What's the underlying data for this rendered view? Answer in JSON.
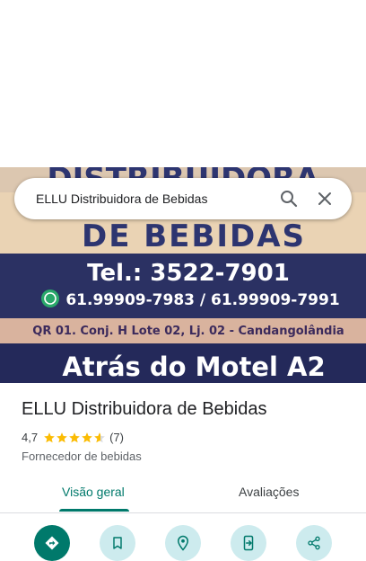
{
  "search": {
    "query": "ELLU Distribuidora de Bebidas"
  },
  "hero": {
    "line1": "DISTRIBUIDORA",
    "line2": "DE BEBIDAS",
    "phone_main": "Tel.: 3522-7901",
    "phones_whatsapp": "61.99909-7983  /  61.99909-7991",
    "address": "QR 01. Conj. H Lote 02, Lj. 02 - Candangolândia",
    "reference": "Atrás do Motel A2"
  },
  "place": {
    "name": "ELLU Distribuidora de Bebidas",
    "rating": "4,7",
    "rating_value": 4.7,
    "reviews_count": "(7)",
    "category": "Fornecedor de bebidas"
  },
  "tabs": [
    {
      "label": "Visão geral",
      "active": true
    },
    {
      "label": "Avaliações",
      "active": false
    }
  ],
  "actions": [
    "directions-icon",
    "bookmark-icon",
    "nearby-icon",
    "send-to-phone-icon",
    "share-icon"
  ],
  "colors": {
    "accent": "#00796b",
    "star": "#fbbc04",
    "chip": "#cdebee"
  }
}
